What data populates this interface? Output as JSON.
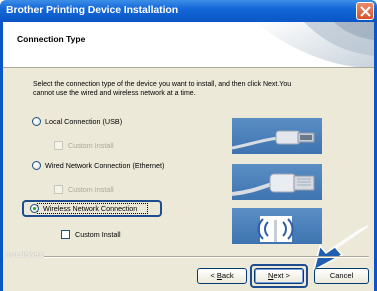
{
  "window": {
    "title": "Brother Printing Device Installation"
  },
  "header": {
    "title": "Connection Type"
  },
  "description": {
    "line1": "Select the connection type of the device you want to install, and then click Next.You",
    "line2": "cannot use the wired and wireless network at a time."
  },
  "options": [
    {
      "label": "Local Connection (USB)",
      "selected": false,
      "sub_label": "Custom Install",
      "sub_enabled": false
    },
    {
      "label": "Wired Network Connection (Ethernet)",
      "selected": false,
      "sub_label": "Custom Install",
      "sub_enabled": false
    },
    {
      "label": "Wireless Network Connection",
      "selected": true,
      "sub_label": "Custom Install",
      "sub_enabled": true
    }
  ],
  "footer": {
    "brand": "InstallShield"
  },
  "buttons": {
    "back": {
      "prefix": "< ",
      "mnemonic": "B",
      "rest": "ack"
    },
    "next": {
      "mnemonic": "N",
      "rest": "ext >"
    },
    "cancel": "Cancel"
  },
  "icons": [
    "close-icon",
    "usb-cable-icon",
    "ethernet-cable-icon",
    "wireless-router-icon",
    "pointer-arrow-icon"
  ],
  "colors": {
    "titlebar": "#0a56c4",
    "selected_radio": "#21a121",
    "highlight": "#1f4c8f"
  }
}
